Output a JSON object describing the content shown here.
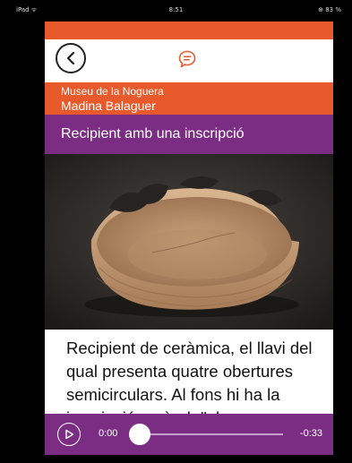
{
  "status_bar": {
    "device": "iPad ᯤ",
    "time": "8:51",
    "battery": "⊕ 83 %"
  },
  "nav": {
    "back_icon": "chevron-left-icon",
    "chat_icon": "chat-bubble-icon"
  },
  "museum": {
    "name": "Museu de la Noguera",
    "subtitle": "Madina Balaguer"
  },
  "title": "Recipient amb una inscripció",
  "description": "Recipient de ceràmica, el llavi del qual presenta quatre obertures semicirculars. Al fons hi ha la inscripció en àrab \"al",
  "player": {
    "current_time": "0:00",
    "remaining_time": "-0:33",
    "progress": 0
  },
  "colors": {
    "accent_orange": "#e85a2c",
    "accent_purple": "#7b2d84"
  }
}
